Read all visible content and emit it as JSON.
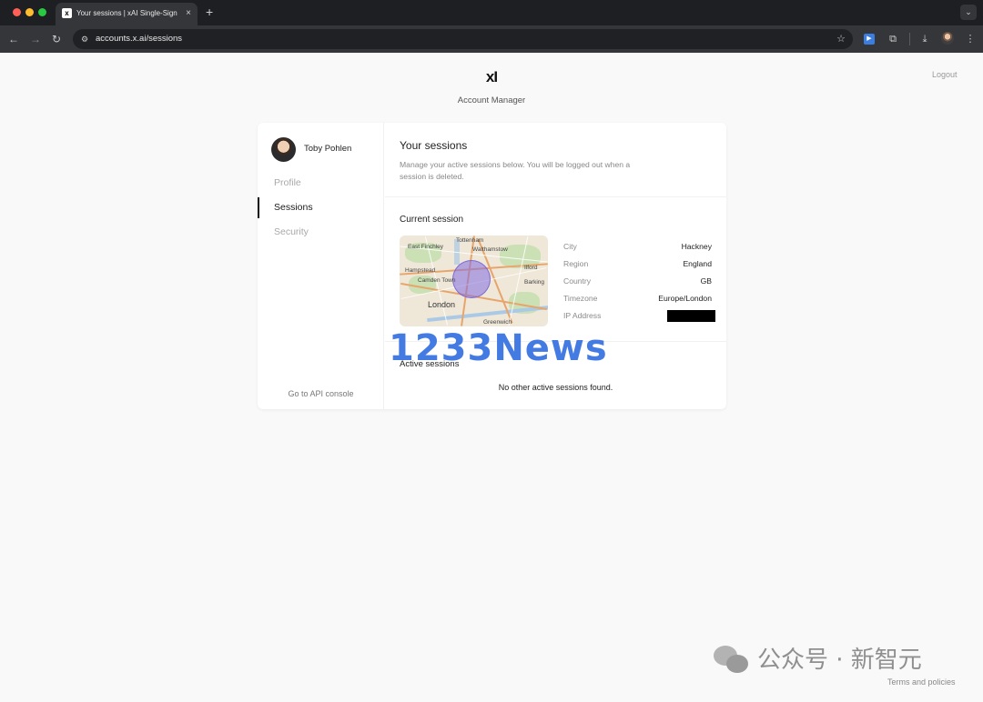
{
  "browser": {
    "tab_title": "Your sessions | xAI Single-Sign",
    "favicon": "xAI",
    "new_tab": "+",
    "close_tab": "×",
    "url": "accounts.x.ai/sessions",
    "tab_menu": "⌄"
  },
  "header": {
    "logo": "xI",
    "title": "Account Manager",
    "logout": "Logout"
  },
  "sidebar": {
    "user_name": "Toby Pohlen",
    "items": [
      {
        "label": "Profile",
        "active": false
      },
      {
        "label": "Sessions",
        "active": true
      },
      {
        "label": "Security",
        "active": false
      }
    ],
    "api_console": "Go to API console"
  },
  "main": {
    "title": "Your sessions",
    "description": "Manage your active sessions below. You will be logged out when a session is deleted.",
    "current_session_title": "Current session",
    "map_labels": {
      "tottenham": "Tottenham",
      "east_finchley": "East Finchley",
      "walthamstow": "Walthamstow",
      "hampstead": "Hampstead",
      "ilford": "Ilford",
      "camden_town": "Camden Town",
      "barking": "Barking",
      "london": "London",
      "greenwich": "Greenwich"
    },
    "session_info": [
      {
        "label": "City",
        "value": "Hackney"
      },
      {
        "label": "Region",
        "value": "England"
      },
      {
        "label": "Country",
        "value": "GB"
      },
      {
        "label": "Timezone",
        "value": "Europe/London"
      },
      {
        "label": "IP Address",
        "value": ""
      }
    ],
    "active_sessions_title": "Active sessions",
    "no_sessions": "No other active sessions found."
  },
  "overlays": {
    "news_watermark": "1233News",
    "wechat_text": "公众号 · 新智元",
    "terms": "Terms and policies"
  },
  "colors": {
    "accent_blue": "#3b74e2",
    "map_circle": "#826ee1"
  }
}
